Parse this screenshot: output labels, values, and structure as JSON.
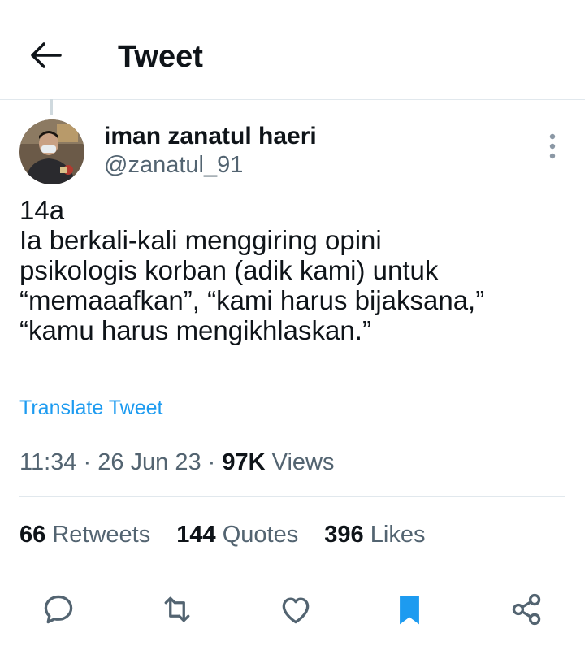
{
  "header": {
    "title": "Tweet",
    "back_icon": "arrow-left-icon"
  },
  "author": {
    "display_name": "iman zanatul haeri",
    "handle": "@zanatul_91"
  },
  "tweet": {
    "lines": [
      "14a",
      "Ia berkali-kali menggiring opini",
      "psikologis korban (adik kami) untuk",
      "“memaaafkan”, “kami harus bijaksana,”",
      "“kamu harus mengikhlaskan.”"
    ],
    "translate_label": "Translate Tweet",
    "time": "11:34",
    "date": "26 Jun 23",
    "separator": "·",
    "views_count": "97K",
    "views_label": "Views"
  },
  "stats": {
    "retweets_count": "66",
    "retweets_label": "Retweets",
    "quotes_count": "144",
    "quotes_label": "Quotes",
    "likes_count": "396",
    "likes_label": "Likes"
  },
  "actions": [
    "reply-icon",
    "retweet-icon",
    "like-icon",
    "bookmark-icon",
    "share-icon"
  ],
  "colors": {
    "link": "#1d9bf0",
    "secondary_text": "#536471",
    "bookmark_active": "#1d9bf0"
  }
}
